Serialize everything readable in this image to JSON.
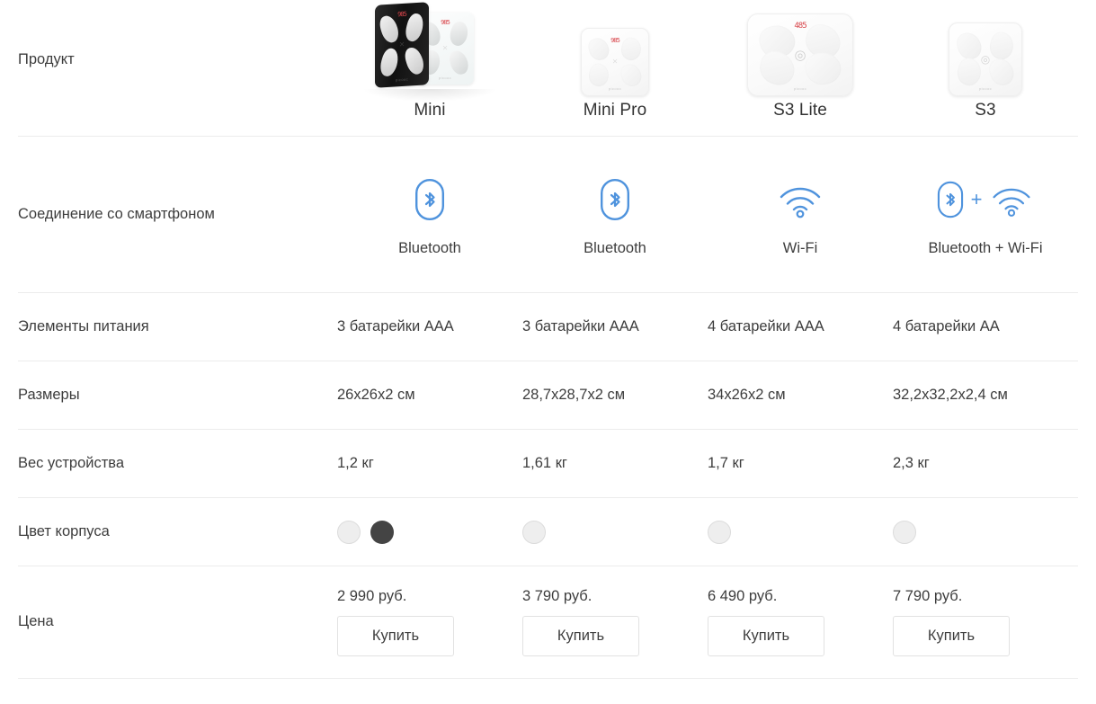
{
  "theme": {
    "accent_blue": "#4f93dd",
    "text": "#3d3d3d",
    "divider": "#ececec",
    "button_border": "#e2e2e2"
  },
  "rows": {
    "product": {
      "label": "Продукт",
      "products": [
        {
          "name": "Mini",
          "image": "scale-mini-black-and-white"
        },
        {
          "name": "Mini Pro",
          "image": "scale-mini-pro-white"
        },
        {
          "name": "S3 Lite",
          "image": "scale-s3-lite-white"
        },
        {
          "name": "S3",
          "image": "scale-s3-white"
        }
      ]
    },
    "connection": {
      "label": "Соединение со смартфоном",
      "values": [
        {
          "text": "Bluetooth",
          "icons": [
            "bluetooth-icon"
          ]
        },
        {
          "text": "Bluetooth",
          "icons": [
            "bluetooth-icon"
          ]
        },
        {
          "text": "Wi-Fi",
          "icons": [
            "wifi-icon"
          ]
        },
        {
          "text": "Bluetooth + Wi-Fi",
          "icons": [
            "bluetooth-icon",
            "plus-icon",
            "wifi-icon"
          ]
        }
      ]
    },
    "battery": {
      "label": "Элементы питания",
      "values": [
        "3 батарейки ААА",
        "3 батарейки ААА",
        "4 батарейки ААА",
        "4 батарейки АА"
      ]
    },
    "dimensions": {
      "label": "Размеры",
      "values": [
        "26х26х2 см",
        "28,7х28,7х2 см",
        "34х26х2 см",
        "32,2х32,2х2,4 см"
      ]
    },
    "weight": {
      "label": "Вес устройства",
      "values": [
        "1,2 кг",
        "1,61 кг",
        "1,7 кг",
        "2,3 кг"
      ]
    },
    "colors": {
      "label": "Цвет корпуса",
      "values": [
        [
          "#eeeeee",
          "#444444"
        ],
        [
          "#eeeeee"
        ],
        [
          "#eeeeee"
        ],
        [
          "#eeeeee"
        ]
      ]
    },
    "price": {
      "label": "Цена",
      "values": [
        "2 990 руб.",
        "3 790 руб.",
        "6 490 руб.",
        "7 790 руб."
      ],
      "buy_label": "Купить"
    }
  }
}
